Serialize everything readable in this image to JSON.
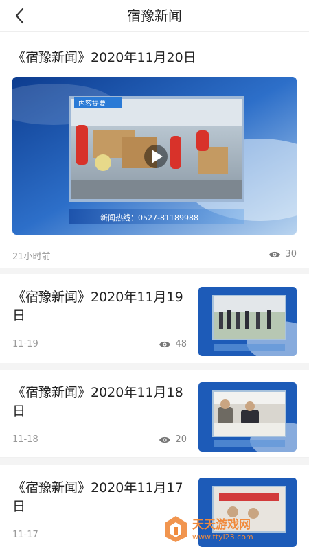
{
  "header": {
    "title": "宿豫新闻",
    "back_icon": "chevron-left-icon"
  },
  "featured": {
    "title": "《宿豫新闻》2020年11月20日",
    "media_tag": "内容提要",
    "hotline": "新闻热线：0527-81189988",
    "time": "21小时前",
    "views": "30",
    "play_icon": "play-icon"
  },
  "news_list": [
    {
      "title": "《宿豫新闻》2020年11月19日",
      "date": "11-19",
      "views": "48"
    },
    {
      "title": "《宿豫新闻》2020年11月18日",
      "date": "11-18",
      "views": "20"
    },
    {
      "title": "《宿豫新闻》2020年11月17日",
      "date": "11-17",
      "views": ""
    }
  ],
  "watermark": {
    "name": "天天游戏网",
    "url": "www.ttyl23.com"
  },
  "colors": {
    "accent_blue": "#1e63c8",
    "watermark_orange": "#f08a3c",
    "meta_gray": "#999999"
  }
}
